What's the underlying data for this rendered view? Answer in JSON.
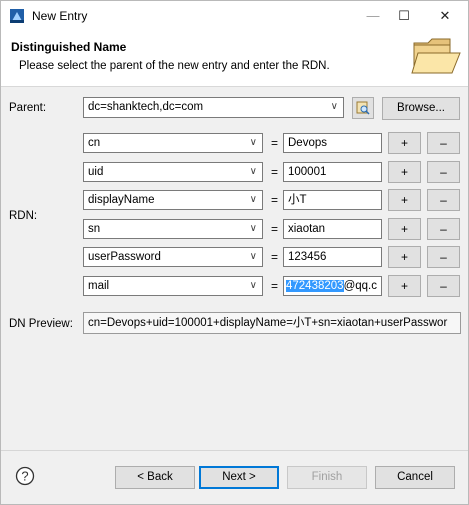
{
  "window": {
    "title": "New Entry",
    "min_glyph": "—",
    "max_glyph": "☐",
    "close_glyph": "✕"
  },
  "banner": {
    "title": "Distinguished Name",
    "description": "Please select the parent of the new entry and enter the RDN."
  },
  "parent": {
    "label": "Parent:",
    "value": "dc=shanktech,dc=com",
    "browse_label": "Browse...",
    "arrow": "∨"
  },
  "rdn": {
    "label": "RDN:",
    "equals": "=",
    "add_label": "+",
    "remove_label": "–",
    "arrow": "∨",
    "rows": [
      {
        "attribute": "cn",
        "value": "Devops"
      },
      {
        "attribute": "uid",
        "value": "100001"
      },
      {
        "attribute": "displayName",
        "value": "小T"
      },
      {
        "attribute": "sn",
        "value": "xiaotan"
      },
      {
        "attribute": "userPassword",
        "value": "123456"
      },
      {
        "attribute": "mail",
        "value_selected": "472438203",
        "value_rest": "@qq.c"
      }
    ]
  },
  "dn_preview": {
    "label": "DN Preview:",
    "value": "cn=Devops+uid=100001+displayName=小T+sn=xiaotan+userPasswor"
  },
  "footer": {
    "help_icon": "?",
    "back_label": "< Back",
    "next_label": "Next >",
    "finish_label": "Finish",
    "cancel_label": "Cancel"
  }
}
